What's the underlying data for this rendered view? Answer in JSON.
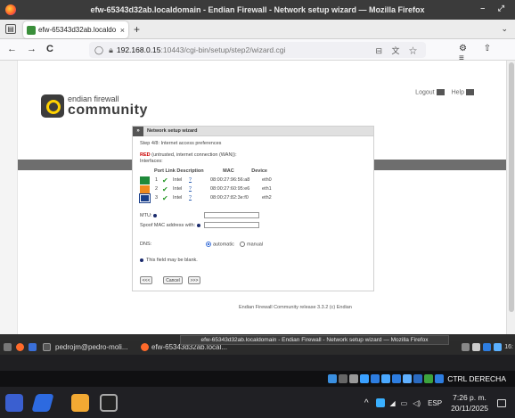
{
  "window": {
    "title": "efw-65343d32ab.localdomain - Endian Firewall - Network setup wizard — Mozilla Firefox",
    "controls": "– ⤢"
  },
  "tab": {
    "title": "efw-65343d32ab.localdo",
    "close": "×",
    "new": "+"
  },
  "nav": {
    "back": "←",
    "forward": "→",
    "reload": "C",
    "url_host": "192.168.0.15",
    "url_path": ":10443/cgi-bin/setup/step2/wizard.cgi",
    "right_icons": "⊟ 文 ☆",
    "ext_icons": "⚙ ⇧ ≡"
  },
  "page": {
    "logo_line1": "endian firewall",
    "logo_line2": "community",
    "logout": "Logout",
    "help": "Help",
    "wizard_title": "Network setup wizard",
    "wizard_tag": "»",
    "step": "Step 4/8: Internet access preferences",
    "red_label": "RED",
    "red_desc": "(untrusted, internet connection (WAN)):",
    "interfaces_label": "Interfaces:",
    "col_headers": [
      "Port",
      "Link",
      "Description",
      "MAC",
      "Device"
    ],
    "interfaces": [
      {
        "port": "1",
        "desc": "Intel",
        "q": "?",
        "mac": "08:00:27:96:56:a8",
        "dev": "eth0",
        "color": "#1f8a3a"
      },
      {
        "port": "2",
        "desc": "Intel",
        "q": "?",
        "mac": "08:00:27:60:95:e6",
        "dev": "eth1",
        "color": "#f08a1e"
      },
      {
        "port": "3",
        "desc": "Intel",
        "q": "?",
        "mac": "08:00:27:82:3e:f0",
        "dev": "eth2",
        "color": "#1a3f8a"
      }
    ],
    "mtu_label": "MTU:",
    "spoof_label": "Spoof MAC address with:",
    "dns_label": "DNS:",
    "dns_auto": "automatic",
    "dns_manual": "manual",
    "blank_note": "This field may be blank.",
    "btn_back": "<<<",
    "btn_cancel": "Cancel",
    "btn_next": ">>>",
    "footer": "Endian Firewall Community release 3.3.2 (c) Endian"
  },
  "taskbar1": {
    "item1": "pedrojm@pedro-moli...",
    "item2": "efw-65343d32ab.local...",
    "tooltip": "efw-65343d32ab.localdomain - Endian Firewall - Network setup wizard — Mozilla Firefox",
    "corner": "16:"
  },
  "tray": {
    "ctrl": "CTRL DERECHA"
  },
  "taskbar2": {
    "lang": "ESP",
    "time": "7:26 p. m.",
    "date": "20/11/2025"
  },
  "colors": {
    "accent_green": "#1f8a3a",
    "menubar": "#6e6e6e"
  }
}
